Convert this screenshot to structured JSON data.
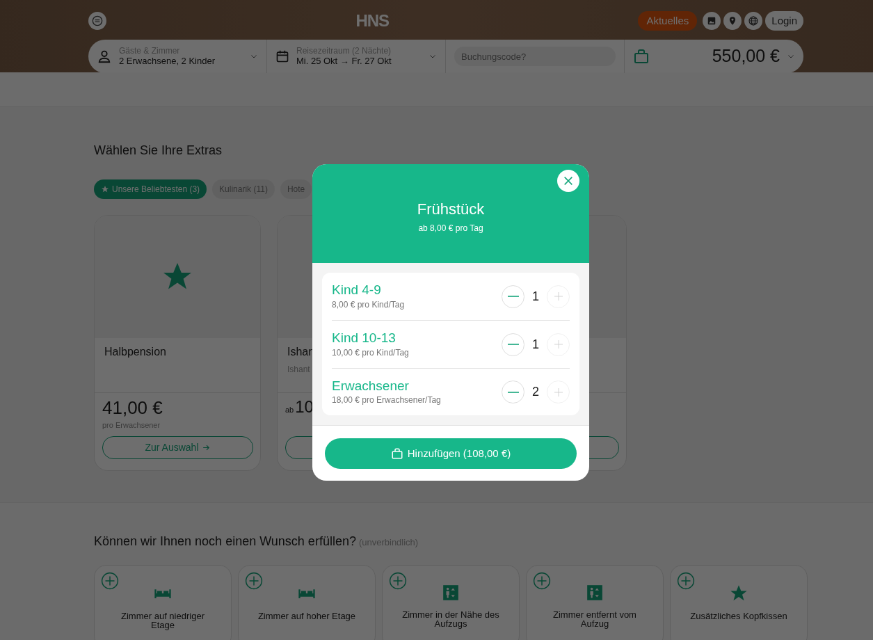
{
  "header": {
    "logo": "HNS",
    "news_button": "Aktuelles",
    "login_button": "Login"
  },
  "booking_bar": {
    "guests_label": "Gäste & Zimmer",
    "guests_value": "2 Erwachsene, 2 Kinder",
    "period_label": "Reisezeitraum (2 Nächte)",
    "period_value": "Mi. 25 Okt → Fr. 27 Okt",
    "code_placeholder": "Buchungscode?",
    "total": "550,00 €"
  },
  "extras": {
    "title": "Wählen Sie Ihre Extras",
    "filters": [
      {
        "label": "Unsere Beliebtesten (3)",
        "selected": true,
        "kind": "star"
      },
      {
        "label": "Kulinarik (11)",
        "selected": false,
        "kind": "plain"
      },
      {
        "label": "Hote",
        "selected": false,
        "kind": "plain"
      }
    ],
    "cards": [
      {
        "kind": "star",
        "title": "Halbpension",
        "price": "41,00 €",
        "unit": "pro Erwachsener",
        "button": "Zur Auswahl"
      },
      {
        "kind": "blank",
        "title": "Ishan",
        "subtitle": "Ishant",
        "price_prefix": "ab",
        "price": "10"
      },
      {
        "kind": "covered"
      }
    ]
  },
  "modal": {
    "title": "Frühstück",
    "subtitle": "ab 8,00 € pro Tag",
    "options": [
      {
        "name": "Kind 4-9",
        "price": "8,00 € pro Kind/Tag",
        "count": "1",
        "can_increase": false
      },
      {
        "name": "Kind 10-13",
        "price": "10,00 € pro Kind/Tag",
        "count": "1",
        "can_increase": false
      },
      {
        "name": "Erwachsener",
        "price": "18,00 € pro Erwachsener/Tag",
        "count": "2",
        "can_increase": false
      }
    ],
    "add_button": "Hinzufügen (108,00 €)"
  },
  "wishes": {
    "title": "Können wir Ihnen noch einen Wunsch erfüllen?",
    "note": "(unverbindlich)",
    "items": [
      {
        "kind": "bed",
        "label": "Zimmer auf niedriger Etage"
      },
      {
        "kind": "bed",
        "label": "Zimmer auf hoher Etage"
      },
      {
        "kind": "elevator",
        "label": "Zimmer in der Nähe des Aufzugs"
      },
      {
        "kind": "elevator",
        "label": "Zimmer entfernt vom Aufzug"
      },
      {
        "kind": "star",
        "label": "Zusätzliches Kopfkissen"
      }
    ]
  }
}
